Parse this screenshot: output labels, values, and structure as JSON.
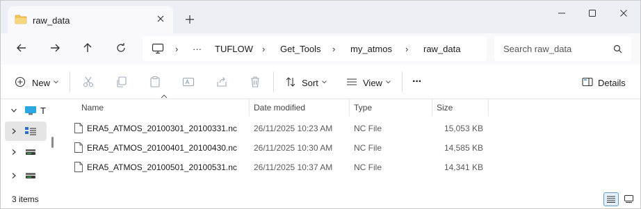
{
  "tab": {
    "title": "raw_data"
  },
  "breadcrumb": {
    "overflow": "···",
    "items": [
      "TUFLOW",
      "Get_Tools",
      "my_atmos",
      "raw_data"
    ]
  },
  "search": {
    "placeholder": "Search raw_data"
  },
  "commands": {
    "new_label": "New",
    "sort_label": "Sort",
    "view_label": "View",
    "more_label": "···",
    "details_label": "Details"
  },
  "navpane": {
    "items": [
      {
        "label": "T",
        "icon": "desktop-icon"
      },
      {
        "label": "",
        "icon": "network-drive-icon"
      },
      {
        "label": "",
        "icon": "drive-icon"
      },
      {
        "label": "",
        "icon": "drive-icon"
      }
    ]
  },
  "columns": [
    "Name",
    "Date modified",
    "Type",
    "Size"
  ],
  "files": [
    {
      "name": "ERA5_ATMOS_20100301_20100331.nc",
      "date": "26/11/2025 10:23 AM",
      "type": "NC File",
      "size": "15,053 KB"
    },
    {
      "name": "ERA5_ATMOS_20100401_20100430.nc",
      "date": "26/11/2025 10:30 AM",
      "type": "NC File",
      "size": "14,585 KB"
    },
    {
      "name": "ERA5_ATMOS_20100501_20100531.nc",
      "date": "26/11/2025 10:37 AM",
      "type": "NC File",
      "size": "14,341 KB"
    }
  ],
  "status": {
    "items_text": "3 items"
  },
  "colors": {
    "tabstrip": "#eceff4",
    "accent": "#0067c0",
    "folder": "#f2c55c"
  }
}
